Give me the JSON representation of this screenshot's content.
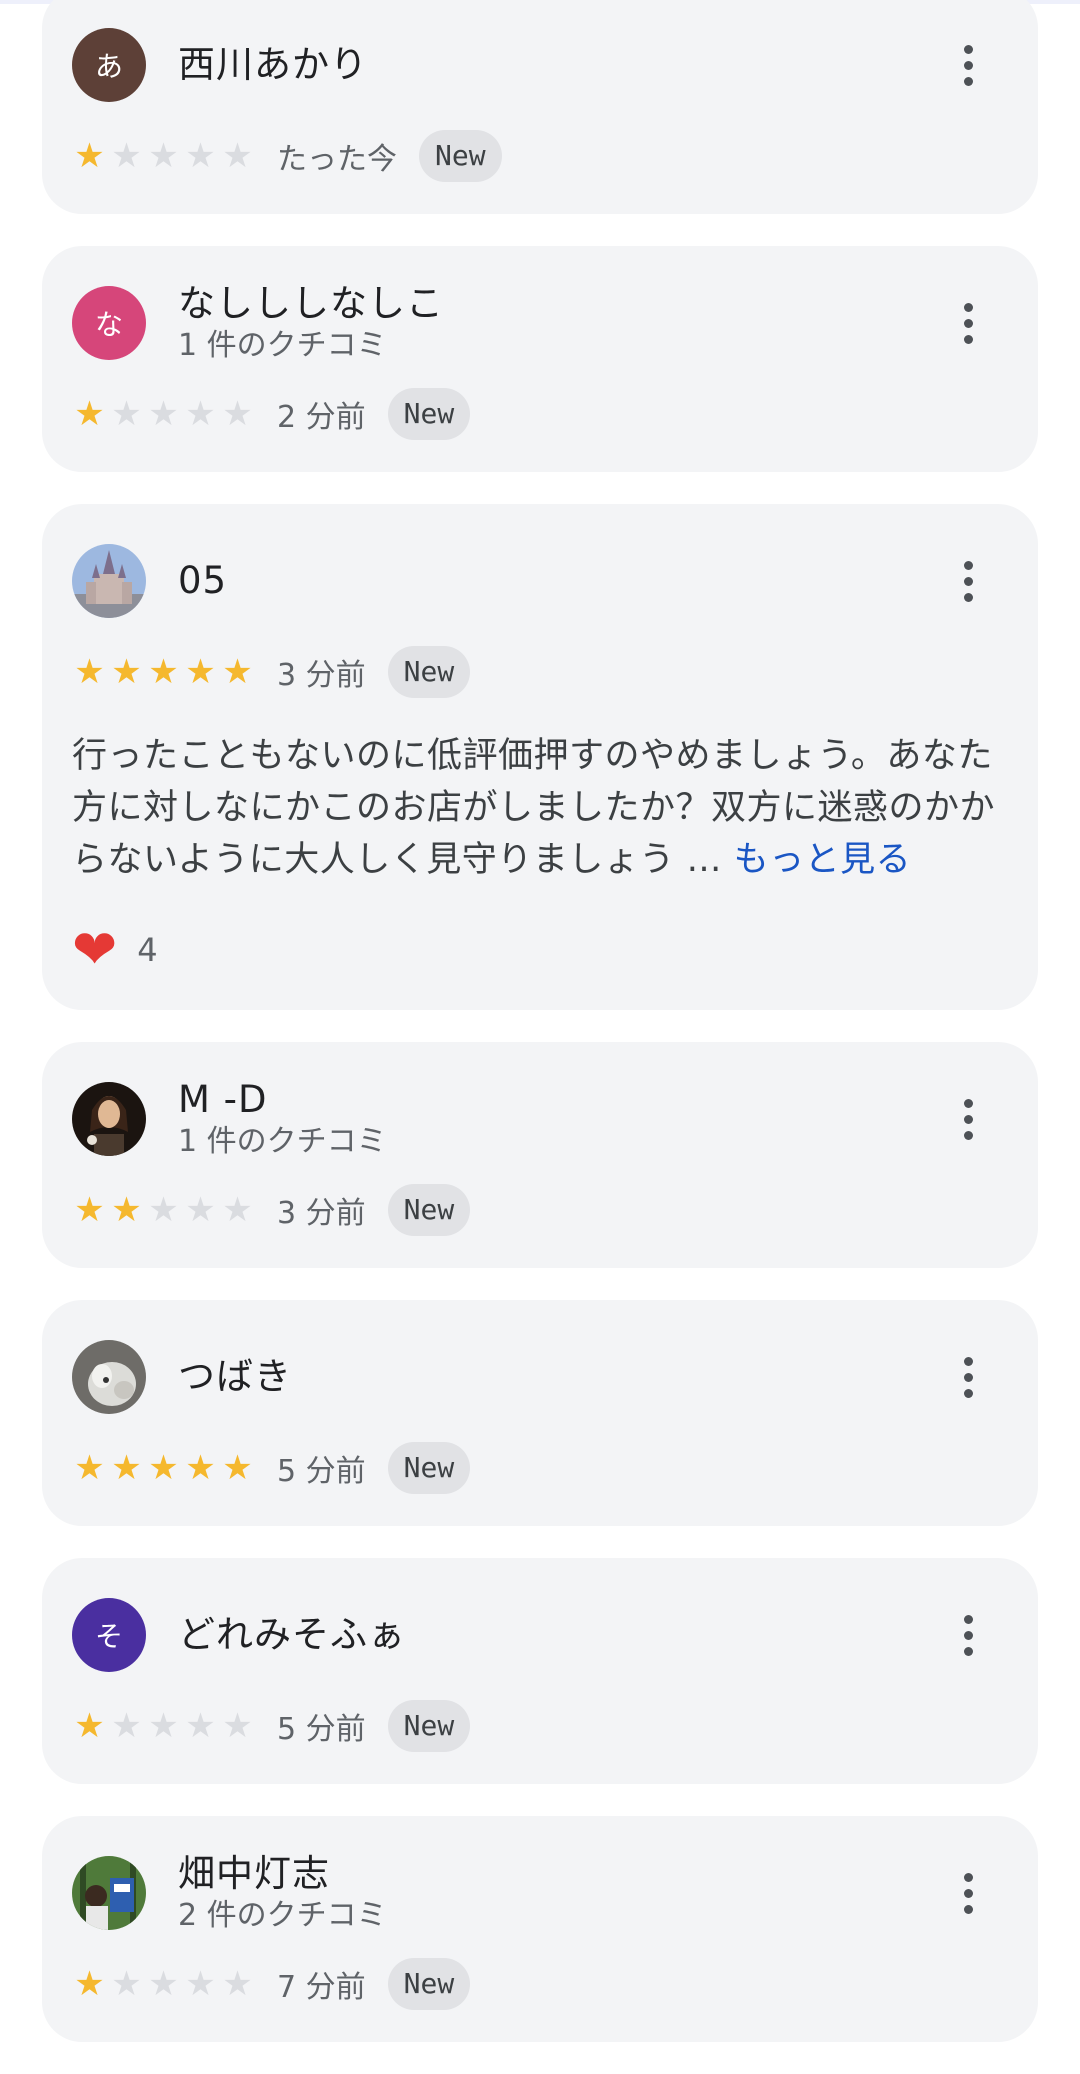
{
  "reviews": [
    {
      "name": "西川あかり",
      "review_count": "",
      "avatar": {
        "type": "letter",
        "letter": "あ",
        "color": "#5d4037"
      },
      "stars": 1,
      "time": "たった今",
      "badge": "New"
    },
    {
      "name": "なしししなしこ",
      "review_count": "1 件のクチコミ",
      "avatar": {
        "type": "letter",
        "letter": "な",
        "color": "#d6467a"
      },
      "stars": 1,
      "time": "2 分前",
      "badge": "New"
    },
    {
      "name": "05",
      "review_count": "",
      "avatar": {
        "type": "photo",
        "icon": "castle-photo"
      },
      "stars": 5,
      "time": "3 分前",
      "badge": "New",
      "text": "行ったこともないのに低評価押すのやめましょう。あなた方に対しなにかこのお店がしましたか？双方に迷惑のかからないように大人しく見守りましょう",
      "ellipsis": " … ",
      "more_label": "もっと見る",
      "likes": "4"
    },
    {
      "name": "M -D",
      "review_count": "1 件のクチコミ",
      "avatar": {
        "type": "photo",
        "icon": "portrait-photo"
      },
      "stars": 2,
      "time": "3 分前",
      "badge": "New"
    },
    {
      "name": "つばき",
      "review_count": "",
      "avatar": {
        "type": "photo",
        "icon": "cat-photo"
      },
      "stars": 5,
      "time": "5 分前",
      "badge": "New"
    },
    {
      "name": "どれみそふぁ",
      "review_count": "",
      "avatar": {
        "type": "letter",
        "letter": "そ",
        "color": "#4a2fa0"
      },
      "stars": 1,
      "time": "5 分前",
      "badge": "New"
    },
    {
      "name": "畑中灯志",
      "review_count": "2 件のクチコミ",
      "avatar": {
        "type": "photo",
        "icon": "forest-photo"
      },
      "stars": 1,
      "time": "7 分前",
      "badge": "New"
    }
  ],
  "colors": {
    "card_bg": "#f3f4f6",
    "star_on": "#f5b82e",
    "star_off": "#dadce0",
    "link": "#1a56c4",
    "heart": "#e53935"
  }
}
